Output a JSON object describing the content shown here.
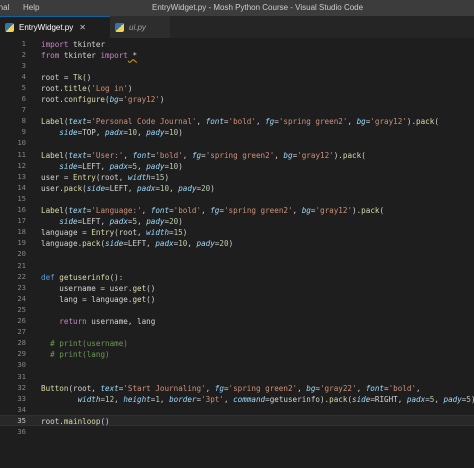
{
  "titlebar": {
    "menu_items": [
      "rnal",
      "Help"
    ],
    "title": "EntryWidget.py - Mosh Python Course - Visual Studio Code"
  },
  "tabs": [
    {
      "label": "EntryWidget.py",
      "active": true,
      "icon": "python-file-icon",
      "close": "✕"
    },
    {
      "label": "ui.py",
      "active": false,
      "icon": "python-file-icon"
    }
  ],
  "editor": {
    "current_line": 35,
    "lines": [
      {
        "n": "1",
        "tokens": [
          [
            "kw",
            "import"
          ],
          [
            "plain",
            " tkinter"
          ]
        ]
      },
      {
        "n": "2",
        "tokens": [
          [
            "kw",
            "from"
          ],
          [
            "plain",
            " tkinter "
          ],
          [
            "kw",
            "import"
          ],
          [
            "plain",
            " *"
          ]
        ]
      },
      {
        "n": "3",
        "tokens": []
      },
      {
        "n": "4",
        "tokens": [
          [
            "plain",
            "root = "
          ],
          [
            "fn",
            "Tk"
          ],
          [
            "plain",
            "()"
          ]
        ]
      },
      {
        "n": "5",
        "tokens": [
          [
            "plain",
            "root."
          ],
          [
            "fn",
            "title"
          ],
          [
            "plain",
            "("
          ],
          [
            "str",
            "'Log in'"
          ],
          [
            "plain",
            ")"
          ]
        ]
      },
      {
        "n": "6",
        "tokens": [
          [
            "plain",
            "root."
          ],
          [
            "fn",
            "configure"
          ],
          [
            "plain",
            "("
          ],
          [
            "param",
            "bg"
          ],
          [
            "plain",
            "="
          ],
          [
            "str",
            "'gray12'"
          ],
          [
            "plain",
            ")"
          ]
        ]
      },
      {
        "n": "7",
        "tokens": []
      },
      {
        "n": "8",
        "tokens": [
          [
            "fn",
            "Label"
          ],
          [
            "plain",
            "("
          ],
          [
            "param",
            "text"
          ],
          [
            "plain",
            "="
          ],
          [
            "str",
            "'Personal Code Journal'"
          ],
          [
            "plain",
            ", "
          ],
          [
            "param",
            "font"
          ],
          [
            "plain",
            "="
          ],
          [
            "str",
            "'bold'"
          ],
          [
            "plain",
            ", "
          ],
          [
            "param",
            "fg"
          ],
          [
            "plain",
            "="
          ],
          [
            "str",
            "'spring green2'"
          ],
          [
            "plain",
            ", "
          ],
          [
            "param",
            "bg"
          ],
          [
            "plain",
            "="
          ],
          [
            "str",
            "'gray12'"
          ],
          [
            "plain",
            ")."
          ],
          [
            "fn",
            "pack"
          ],
          [
            "plain",
            "("
          ]
        ]
      },
      {
        "n": "9",
        "tokens": [
          [
            "plain",
            "    "
          ],
          [
            "param",
            "side"
          ],
          [
            "plain",
            "=TOP, "
          ],
          [
            "param",
            "padx"
          ],
          [
            "plain",
            "="
          ],
          [
            "num",
            "10"
          ],
          [
            "plain",
            ", "
          ],
          [
            "param",
            "pady"
          ],
          [
            "plain",
            "="
          ],
          [
            "num",
            "10"
          ],
          [
            "plain",
            ")"
          ]
        ]
      },
      {
        "n": "10",
        "tokens": []
      },
      {
        "n": "11",
        "tokens": [
          [
            "fn",
            "Label"
          ],
          [
            "plain",
            "("
          ],
          [
            "param",
            "text"
          ],
          [
            "plain",
            "="
          ],
          [
            "str",
            "'User:'"
          ],
          [
            "plain",
            ", "
          ],
          [
            "param",
            "font"
          ],
          [
            "plain",
            "="
          ],
          [
            "str",
            "'bold'"
          ],
          [
            "plain",
            ", "
          ],
          [
            "param",
            "fg"
          ],
          [
            "plain",
            "="
          ],
          [
            "str",
            "'spring green2'"
          ],
          [
            "plain",
            ", "
          ],
          [
            "param",
            "bg"
          ],
          [
            "plain",
            "="
          ],
          [
            "str",
            "'gray12'"
          ],
          [
            "plain",
            ")."
          ],
          [
            "fn",
            "pack"
          ],
          [
            "plain",
            "("
          ]
        ]
      },
      {
        "n": "12",
        "tokens": [
          [
            "plain",
            "    "
          ],
          [
            "param",
            "side"
          ],
          [
            "plain",
            "=LEFT, "
          ],
          [
            "param",
            "padx"
          ],
          [
            "plain",
            "="
          ],
          [
            "num",
            "5"
          ],
          [
            "plain",
            ", "
          ],
          [
            "param",
            "pady"
          ],
          [
            "plain",
            "="
          ],
          [
            "num",
            "10"
          ],
          [
            "plain",
            ")"
          ]
        ]
      },
      {
        "n": "13",
        "tokens": [
          [
            "plain",
            "user = "
          ],
          [
            "fn",
            "Entry"
          ],
          [
            "plain",
            "(root, "
          ],
          [
            "param",
            "width"
          ],
          [
            "plain",
            "="
          ],
          [
            "num",
            "15"
          ],
          [
            "plain",
            ")"
          ]
        ]
      },
      {
        "n": "14",
        "tokens": [
          [
            "plain",
            "user."
          ],
          [
            "fn",
            "pack"
          ],
          [
            "plain",
            "("
          ],
          [
            "param",
            "side"
          ],
          [
            "plain",
            "=LEFT, "
          ],
          [
            "param",
            "padx"
          ],
          [
            "plain",
            "="
          ],
          [
            "num",
            "10"
          ],
          [
            "plain",
            ", "
          ],
          [
            "param",
            "pady"
          ],
          [
            "plain",
            "="
          ],
          [
            "num",
            "20"
          ],
          [
            "plain",
            ")"
          ]
        ]
      },
      {
        "n": "15",
        "tokens": []
      },
      {
        "n": "16",
        "tokens": [
          [
            "fn",
            "Label"
          ],
          [
            "plain",
            "("
          ],
          [
            "param",
            "text"
          ],
          [
            "plain",
            "="
          ],
          [
            "str",
            "'Language:'"
          ],
          [
            "plain",
            ", "
          ],
          [
            "param",
            "font"
          ],
          [
            "plain",
            "="
          ],
          [
            "str",
            "'bold'"
          ],
          [
            "plain",
            ", "
          ],
          [
            "param",
            "fg"
          ],
          [
            "plain",
            "="
          ],
          [
            "str",
            "'spring green2'"
          ],
          [
            "plain",
            ", "
          ],
          [
            "param",
            "bg"
          ],
          [
            "plain",
            "="
          ],
          [
            "str",
            "'gray12'"
          ],
          [
            "plain",
            ")."
          ],
          [
            "fn",
            "pack"
          ],
          [
            "plain",
            "("
          ]
        ]
      },
      {
        "n": "17",
        "tokens": [
          [
            "plain",
            "    "
          ],
          [
            "param",
            "side"
          ],
          [
            "plain",
            "=LEFT, "
          ],
          [
            "param",
            "padx"
          ],
          [
            "plain",
            "="
          ],
          [
            "num",
            "5"
          ],
          [
            "plain",
            ", "
          ],
          [
            "param",
            "pady"
          ],
          [
            "plain",
            "="
          ],
          [
            "num",
            "20"
          ],
          [
            "plain",
            ")"
          ]
        ]
      },
      {
        "n": "18",
        "tokens": [
          [
            "plain",
            "language = "
          ],
          [
            "fn",
            "Entry"
          ],
          [
            "plain",
            "(root, "
          ],
          [
            "param",
            "width"
          ],
          [
            "plain",
            "="
          ],
          [
            "num",
            "15"
          ],
          [
            "plain",
            ")"
          ]
        ]
      },
      {
        "n": "19",
        "tokens": [
          [
            "plain",
            "language."
          ],
          [
            "fn",
            "pack"
          ],
          [
            "plain",
            "("
          ],
          [
            "param",
            "side"
          ],
          [
            "plain",
            "=LEFT, "
          ],
          [
            "param",
            "padx"
          ],
          [
            "plain",
            "="
          ],
          [
            "num",
            "10"
          ],
          [
            "plain",
            ", "
          ],
          [
            "param",
            "pady"
          ],
          [
            "plain",
            "="
          ],
          [
            "num",
            "20"
          ],
          [
            "plain",
            ")"
          ]
        ]
      },
      {
        "n": "20",
        "tokens": []
      },
      {
        "n": "21",
        "tokens": []
      },
      {
        "n": "22",
        "tokens": [
          [
            "kwb",
            "def"
          ],
          [
            "plain",
            " "
          ],
          [
            "fn",
            "getuserinfo"
          ],
          [
            "plain",
            "():"
          ]
        ]
      },
      {
        "n": "23",
        "tokens": [
          [
            "plain",
            "    username = user."
          ],
          [
            "fn",
            "get"
          ],
          [
            "plain",
            "()"
          ]
        ]
      },
      {
        "n": "24",
        "tokens": [
          [
            "plain",
            "    lang = language."
          ],
          [
            "fn",
            "get"
          ],
          [
            "plain",
            "()"
          ]
        ]
      },
      {
        "n": "25",
        "tokens": []
      },
      {
        "n": "26",
        "tokens": [
          [
            "plain",
            "    "
          ],
          [
            "kw",
            "return"
          ],
          [
            "plain",
            " username, lang"
          ]
        ]
      },
      {
        "n": "27",
        "tokens": []
      },
      {
        "n": "28",
        "tokens": [
          [
            "plain",
            "  "
          ],
          [
            "cm",
            "# print(username)"
          ]
        ]
      },
      {
        "n": "29",
        "tokens": [
          [
            "plain",
            "  "
          ],
          [
            "cm",
            "# print(lang)"
          ]
        ]
      },
      {
        "n": "30",
        "tokens": []
      },
      {
        "n": "31",
        "tokens": []
      },
      {
        "n": "32",
        "tokens": [
          [
            "fn",
            "Button"
          ],
          [
            "plain",
            "(root, "
          ],
          [
            "param",
            "text"
          ],
          [
            "plain",
            "="
          ],
          [
            "str",
            "'Start Journaling'"
          ],
          [
            "plain",
            ", "
          ],
          [
            "param",
            "fg"
          ],
          [
            "plain",
            "="
          ],
          [
            "str",
            "'spring green2'"
          ],
          [
            "plain",
            ", "
          ],
          [
            "param",
            "bg"
          ],
          [
            "plain",
            "="
          ],
          [
            "str",
            "'gray22'"
          ],
          [
            "plain",
            ", "
          ],
          [
            "param",
            "font"
          ],
          [
            "plain",
            "="
          ],
          [
            "str",
            "'bold'"
          ],
          [
            "plain",
            ","
          ]
        ]
      },
      {
        "n": "33",
        "tokens": [
          [
            "plain",
            "        "
          ],
          [
            "param",
            "width"
          ],
          [
            "plain",
            "="
          ],
          [
            "num",
            "12"
          ],
          [
            "plain",
            ", "
          ],
          [
            "param",
            "height"
          ],
          [
            "plain",
            "="
          ],
          [
            "num",
            "1"
          ],
          [
            "plain",
            ", "
          ],
          [
            "param",
            "border"
          ],
          [
            "plain",
            "="
          ],
          [
            "str",
            "'3pt'"
          ],
          [
            "plain",
            ", "
          ],
          [
            "param",
            "command"
          ],
          [
            "plain",
            "=getuserinfo)."
          ],
          [
            "fn",
            "pack"
          ],
          [
            "plain",
            "("
          ],
          [
            "param",
            "side"
          ],
          [
            "plain",
            "=RIGHT, "
          ],
          [
            "param",
            "padx"
          ],
          [
            "plain",
            "="
          ],
          [
            "num",
            "5"
          ],
          [
            "plain",
            ", "
          ],
          [
            "param",
            "pady"
          ],
          [
            "plain",
            "="
          ],
          [
            "num",
            "5"
          ],
          [
            "plain",
            ")"
          ]
        ]
      },
      {
        "n": "34",
        "tokens": []
      },
      {
        "n": "35",
        "tokens": [
          [
            "plain",
            "root."
          ],
          [
            "fn",
            "mainloop"
          ],
          [
            "plain",
            "()"
          ]
        ]
      },
      {
        "n": "36",
        "tokens": []
      }
    ]
  },
  "colors": {
    "background": "#1e1e1e",
    "keyword": "#c586c0",
    "def_keyword": "#569cd6",
    "function": "#dcdcaa",
    "string": "#ce9178",
    "number": "#b5cea8",
    "parameter": "#9cdcfe",
    "comment": "#6a9955"
  }
}
